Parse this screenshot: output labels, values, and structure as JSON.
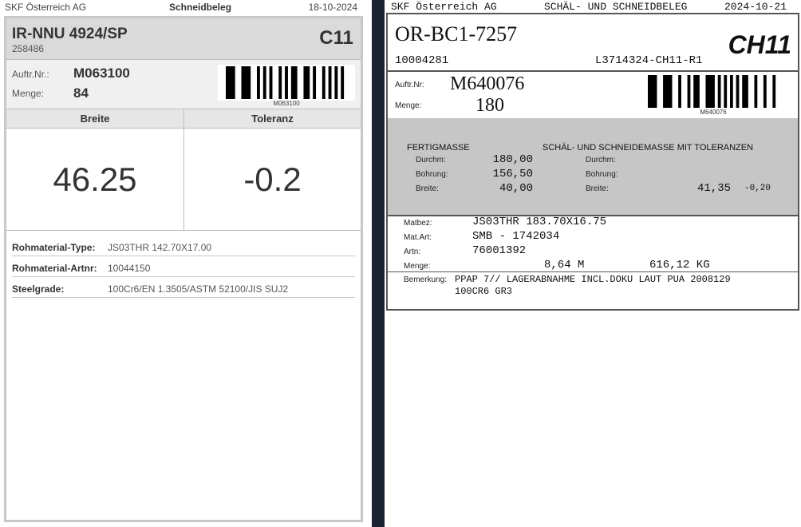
{
  "left": {
    "company": "SKF Österreich AG",
    "doc_title": "Schneidbeleg",
    "date": "18-10-2024",
    "part_name": "IR-NNU 4924/SP",
    "part_no": "258486",
    "machine_code": "C11",
    "order_label": "Auftr.Nr.:",
    "order_value": "M063100",
    "qty_label": "Menge:",
    "qty_value": "84",
    "barcode_text": "M063100",
    "col_width_label": "Breite",
    "col_tol_label": "Toleranz",
    "width_value": "46.25",
    "tolerance_value": "-0.2",
    "properties": [
      {
        "label": "Rohmaterial-Type:",
        "value": "JS03THR 142.70X17.00"
      },
      {
        "label": "Rohmaterial-Artnr:",
        "value": "10044150"
      },
      {
        "label": "Steelgrade:",
        "value": "100Cr6/EN 1.3505/ASTM 52100/JIS SUJ2"
      }
    ]
  },
  "right": {
    "company": "SKF Österreich AG",
    "doc_title": "SCHÄL- UND SCHNEIDBELEG",
    "date": "2024-10-21",
    "part_id": "OR-BC1-7257",
    "machine_code": "CH11",
    "number_left": "10004281",
    "number_right": "L3714324-CH11-R1",
    "order_label": "Auftr.Nr:",
    "order_value": "M640076",
    "qty_label": "Menge:",
    "qty_value": "180",
    "barcode_text": "M640076",
    "section_finished": "FERTIGMASSE",
    "section_tolerances": "SCHÄL- UND SCHNEIDEMASSE MIT TOLERANZEN",
    "dim_labels": [
      "Durchm:",
      "Bohrung:",
      "Breite:"
    ],
    "finished_values": [
      "180,00",
      "156,50",
      "40,00"
    ],
    "cut_labels": [
      "Durchm:",
      "Bohrung:",
      "Breite:"
    ],
    "cut_width_value": "41,35",
    "cut_width_tol": "-0,20",
    "matbez_label": "Matbez:",
    "matbez_value": "JS03THR 183.70X16.75",
    "matart_label": "Mat.Art:",
    "matart_value": "SMB - 1742034",
    "artn_label": "Artn:",
    "artn_value": "76001392",
    "menge_label": "Menge:",
    "menge_m": "8,64 M",
    "menge_kg": "616,12 KG",
    "remark_label": "Bemerkung:",
    "remark_line1": "PPAP 7// LAGERABNAHME INCL.DOKU LAUT PUA 2008129",
    "remark_line2": "100CR6 GR3"
  }
}
